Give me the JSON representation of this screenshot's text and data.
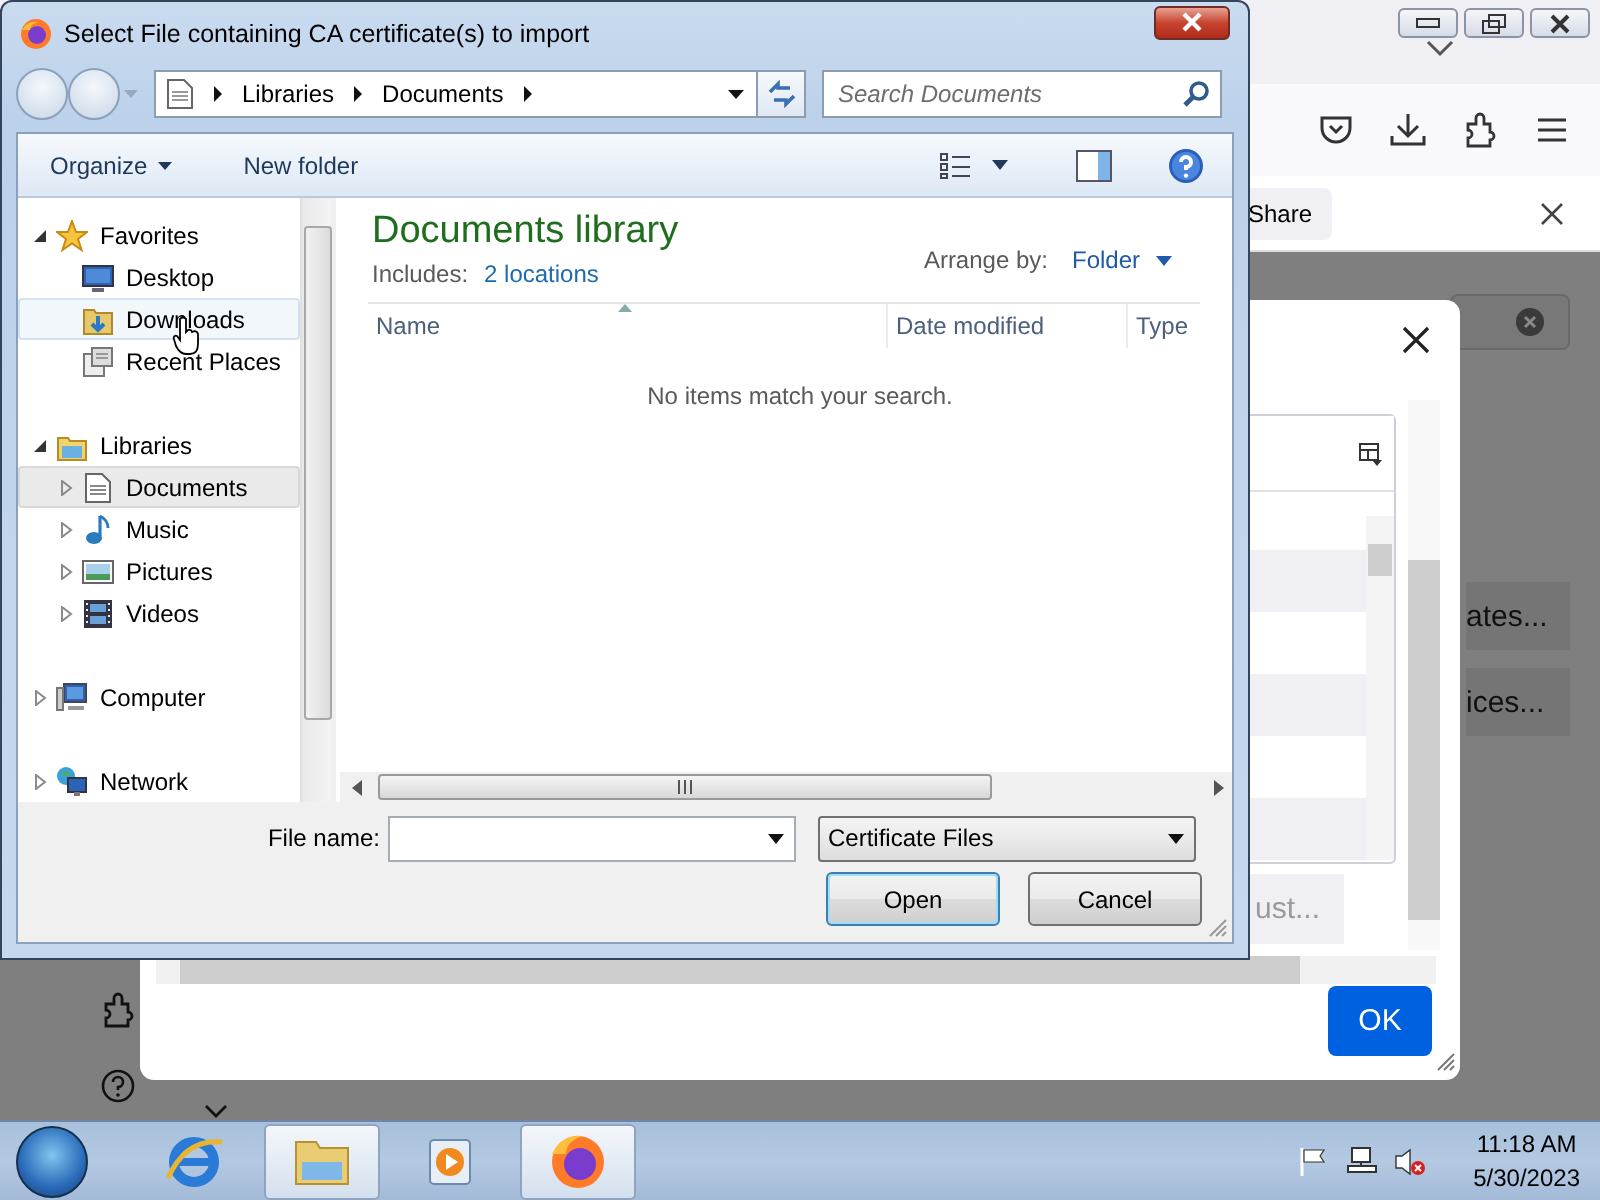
{
  "browser": {
    "notification": {
      "button": "Share"
    },
    "background_buttons": [
      "ates...",
      "ices..."
    ]
  },
  "certificate_dialog": {
    "partial_button": "ust...",
    "ok_button": "OK"
  },
  "file_dialog": {
    "title": "Select File containing CA certificate(s) to import",
    "breadcrumb": [
      "Libraries",
      "Documents"
    ],
    "search": {
      "placeholder": "Search Documents"
    },
    "toolbar": {
      "organize": "Organize",
      "new_folder": "New folder"
    },
    "nav_tree": [
      {
        "label": "Favorites",
        "kind": "favorites",
        "expanded": true,
        "selected": false,
        "hovered": false,
        "children": [
          {
            "label": "Desktop",
            "kind": "desktop",
            "selected": false,
            "hovered": false
          },
          {
            "label": "Downloads",
            "kind": "downloads",
            "selected": false,
            "hovered": true
          },
          {
            "label": "Recent Places",
            "kind": "recent",
            "selected": false,
            "hovered": false
          }
        ]
      },
      {
        "label": "Libraries",
        "kind": "libraries",
        "expanded": true,
        "selected": false,
        "hovered": false,
        "children": [
          {
            "label": "Documents",
            "kind": "documents",
            "expanded": false,
            "selected": true,
            "hovered": false
          },
          {
            "label": "Music",
            "kind": "music",
            "expanded": false,
            "selected": false,
            "hovered": false
          },
          {
            "label": "Pictures",
            "kind": "pictures",
            "expanded": false,
            "selected": false,
            "hovered": false
          },
          {
            "label": "Videos",
            "kind": "videos",
            "expanded": false,
            "selected": false,
            "hovered": false
          }
        ]
      },
      {
        "label": "Computer",
        "kind": "computer",
        "expanded": false,
        "selected": false,
        "hovered": false
      },
      {
        "label": "Network",
        "kind": "network",
        "expanded": false,
        "selected": false,
        "hovered": false
      }
    ],
    "library": {
      "title": "Documents library",
      "includes_label": "Includes:",
      "includes_link": "2 locations",
      "arrange_label": "Arrange by:",
      "arrange_value": "Folder"
    },
    "columns": [
      "Name",
      "Date modified",
      "Type"
    ],
    "empty_message": "No items match your search.",
    "file_name_label": "File name:",
    "filter": "Certificate Files",
    "buttons": [
      {
        "label": "Open",
        "default": true
      },
      {
        "label": "Cancel",
        "default": false
      }
    ]
  },
  "taskbar": {
    "apps": [
      {
        "kind": "browser-e",
        "active": false
      },
      {
        "kind": "folder",
        "active": true
      },
      {
        "kind": "media",
        "active": false
      },
      {
        "kind": "firefox",
        "active": true
      }
    ],
    "clock": {
      "time": "11:18 AM",
      "date": "5/30/2023"
    }
  }
}
